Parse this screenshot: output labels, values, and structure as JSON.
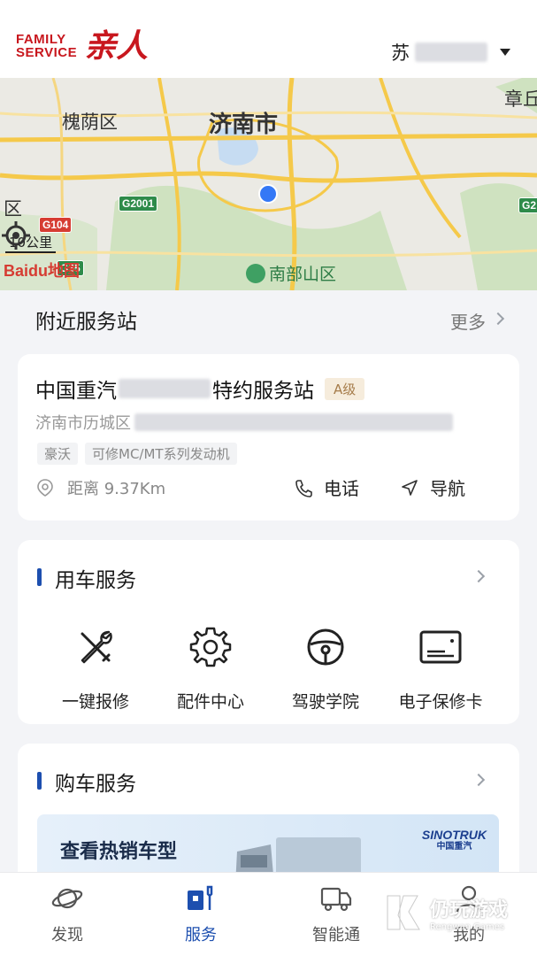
{
  "header": {
    "brand_en_line1": "FAMILY",
    "brand_en_line2": "SERVICE",
    "brand_cn": "亲人",
    "user_prefix": "苏"
  },
  "map": {
    "city": "济南市",
    "district_left": "槐荫区",
    "district_south": "南部山区",
    "district_right": "章丘",
    "edge_label": "区",
    "road_g2001": "G2001",
    "road_g104": "G104",
    "road_g35": "G35",
    "road_g2": "G2",
    "scale_label": "10公里",
    "baidu_logo": "Baidu地图",
    "colors": {
      "road": "#f5c94a",
      "green": "#c9dfb9",
      "water": "#c9def5"
    }
  },
  "nearby": {
    "title": "附近服务站",
    "more": "更多",
    "station": {
      "name_prefix": "中国重汽",
      "name_suffix": "特约服务站",
      "grade": "A级",
      "address_prefix": "济南市历城区",
      "tags": [
        "豪沃",
        "可修MC/MT系列发动机"
      ],
      "distance": "距离 9.37Km",
      "phone": "电话",
      "navigate": "导航"
    }
  },
  "car_service": {
    "title": "用车服务",
    "items": [
      {
        "label": "一键报修",
        "icon": "repair-tools-icon"
      },
      {
        "label": "配件中心",
        "icon": "gear-icon"
      },
      {
        "label": "驾驶学院",
        "icon": "steering-wheel-icon"
      },
      {
        "label": "电子保修卡",
        "icon": "card-icon"
      }
    ]
  },
  "purchase_service": {
    "title": "购车服务",
    "banner_title": "查看热销车型",
    "banner_brand": "SINOTRUK",
    "banner_brand_cn": "中国重汽"
  },
  "tabbar": {
    "items": [
      {
        "label": "发现",
        "icon": "planet-icon"
      },
      {
        "label": "服务",
        "icon": "service-icon",
        "active": true
      },
      {
        "label": "智能通",
        "icon": "truck-icon"
      },
      {
        "label": "我的",
        "icon": "profile-icon"
      }
    ]
  },
  "watermark": {
    "text": "仍玩游戏",
    "sub": "Rengwan Games"
  },
  "accent_color": "#1d4faf"
}
